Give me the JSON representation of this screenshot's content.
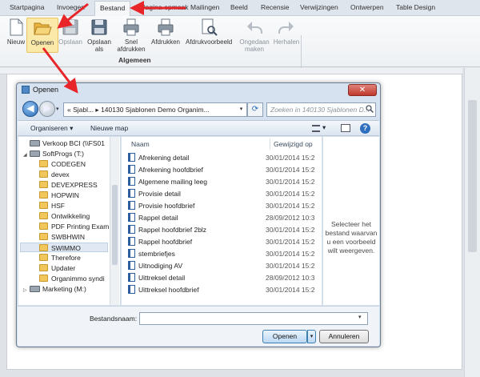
{
  "tabs": [
    "Startpagina",
    "Invoegen",
    "Bestand",
    "Pagina-opmaak",
    "Mailingen",
    "Beeld",
    "Recensie",
    "Verwijzingen",
    "Ontwerpen",
    "Table Design"
  ],
  "active_tab": "Bestand",
  "ribbon": {
    "buttons": [
      {
        "label": "Nieuw",
        "icon": "new-document-icon",
        "enabled": true
      },
      {
        "label": "Openen",
        "icon": "folder-open-icon",
        "enabled": true
      },
      {
        "label": "Opslaan",
        "icon": "save-icon",
        "enabled": false
      },
      {
        "label": "Opslaan als",
        "icon": "save-as-icon",
        "enabled": true
      },
      {
        "label": "Snel afdrukken",
        "icon": "quick-print-icon",
        "enabled": true
      },
      {
        "label": "Afdrukken",
        "icon": "print-icon",
        "enabled": true
      },
      {
        "label": "Afdrukvoorbeeld",
        "icon": "print-preview-icon",
        "enabled": true
      },
      {
        "label": "Ongedaan maken",
        "icon": "undo-icon",
        "enabled": false
      },
      {
        "label": "Herhalen",
        "icon": "redo-icon",
        "enabled": false
      }
    ],
    "group_label": "Algemeen"
  },
  "dialog": {
    "title": "Openen",
    "close_label": "✕",
    "address": "«  Sjabl...  ▸  140130  Sjablonen Demo Organim...",
    "search_placeholder": "Zoeken in 140130  Sjablonen D...",
    "cmd_organize": "Organiseren ▾",
    "cmd_new_folder": "Nieuwe map",
    "tree": [
      {
        "label": "Verkoop BCI (\\\\FS01",
        "type": "drive",
        "indent": 1
      },
      {
        "label": "SoftProgs (T:)",
        "type": "drive",
        "indent": 1
      },
      {
        "label": "CODEGEN",
        "type": "folder",
        "indent": 2
      },
      {
        "label": "devex",
        "type": "folder",
        "indent": 2
      },
      {
        "label": "DEVEXPRESS",
        "type": "folder",
        "indent": 2
      },
      {
        "label": "HOPWIN",
        "type": "folder",
        "indent": 2
      },
      {
        "label": "HSF",
        "type": "folder",
        "indent": 2
      },
      {
        "label": "Ontwikkeling",
        "type": "folder",
        "indent": 2
      },
      {
        "label": "PDF Printing Exam",
        "type": "folder",
        "indent": 2
      },
      {
        "label": "SWBHWIN",
        "type": "folder",
        "indent": 2
      },
      {
        "label": "SWIMMO",
        "type": "folder",
        "indent": 2,
        "selected": true
      },
      {
        "label": "Therefore",
        "type": "folder",
        "indent": 2
      },
      {
        "label": "Updater",
        "type": "folder",
        "indent": 2
      },
      {
        "label": "Organimmo syndi",
        "type": "folder",
        "indent": 2
      },
      {
        "label": "Marketing (M:)",
        "type": "drive",
        "indent": 1
      }
    ],
    "columns": {
      "name": "Naam",
      "modified": "Gewijzigd op"
    },
    "files": [
      {
        "name": "Afrekening detail",
        "date": "30/01/2014 15:2"
      },
      {
        "name": "Afrekening hoofdbrief",
        "date": "30/01/2014 15:2"
      },
      {
        "name": "Algemene mailing leeg",
        "date": "30/01/2014 15:2"
      },
      {
        "name": "Provisie detail",
        "date": "30/01/2014 15:2"
      },
      {
        "name": "Provisie hoofdbrief",
        "date": "30/01/2014 15:2"
      },
      {
        "name": "Rappel detail",
        "date": "28/09/2012 10:3"
      },
      {
        "name": "Rappel hoofdbrief 2blz",
        "date": "30/01/2014 15:2"
      },
      {
        "name": "Rappel hoofdbrief",
        "date": "30/01/2014 15:2"
      },
      {
        "name": "stembriefjes",
        "date": "30/01/2014 15:2"
      },
      {
        "name": "Uitnodiging AV",
        "date": "30/01/2014 15:2"
      },
      {
        "name": "Uittreksel detail",
        "date": "28/09/2012 10:3"
      },
      {
        "name": "Uittreksel hoofdbrief",
        "date": "30/01/2014 15:2"
      }
    ],
    "preview_text": "Selecteer het bestand waarvan u een voorbeeld wilt weergeven.",
    "filename_label": "Bestandsnaam:",
    "filename_value": "",
    "open_label": "Openen",
    "cancel_label": "Annuleren"
  },
  "colors": {
    "accent": "#3c7fb1",
    "annotation_arrow": "#e8262a",
    "selection": "#fbe9a9"
  }
}
